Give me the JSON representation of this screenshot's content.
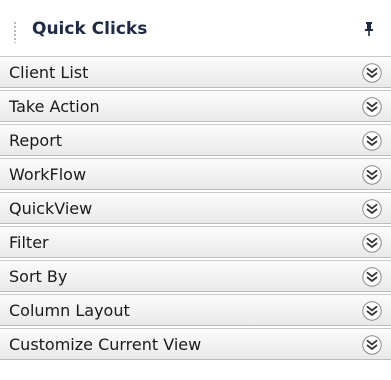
{
  "panel": {
    "title": "Quick Clicks",
    "pin_icon": "pin-icon"
  },
  "items": [
    {
      "label": "Client List",
      "icon": "double-chevron-down-icon"
    },
    {
      "label": "Take Action",
      "icon": "double-chevron-down-icon"
    },
    {
      "label": "Report",
      "icon": "double-chevron-down-icon"
    },
    {
      "label": "WorkFlow",
      "icon": "double-chevron-down-icon"
    },
    {
      "label": "QuickView",
      "icon": "double-chevron-down-icon"
    },
    {
      "label": "Filter",
      "icon": "double-chevron-down-icon"
    },
    {
      "label": "Sort By",
      "icon": "double-chevron-down-icon"
    },
    {
      "label": "Column Layout",
      "icon": "double-chevron-down-icon"
    },
    {
      "label": "Customize Current View",
      "icon": "double-chevron-down-icon"
    }
  ]
}
